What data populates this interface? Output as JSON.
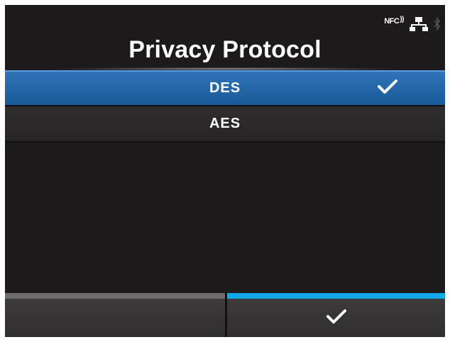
{
  "status_bar": {
    "nfc_label": "NFC",
    "icons": [
      "nfc-icon",
      "network-icon",
      "bluetooth-icon"
    ]
  },
  "header": {
    "title": "Privacy Protocol"
  },
  "options": [
    {
      "label": "DES",
      "selected": true
    },
    {
      "label": "AES",
      "selected": false
    }
  ],
  "soft_keys": {
    "left": {
      "label": "",
      "accent": "#6d6b6c"
    },
    "right": {
      "icon": "check-icon",
      "accent": "#12a6e8"
    }
  },
  "colors": {
    "background": "#1c1a1b",
    "selected_row": "#2e74b8",
    "accent_blue": "#12a6e8"
  }
}
